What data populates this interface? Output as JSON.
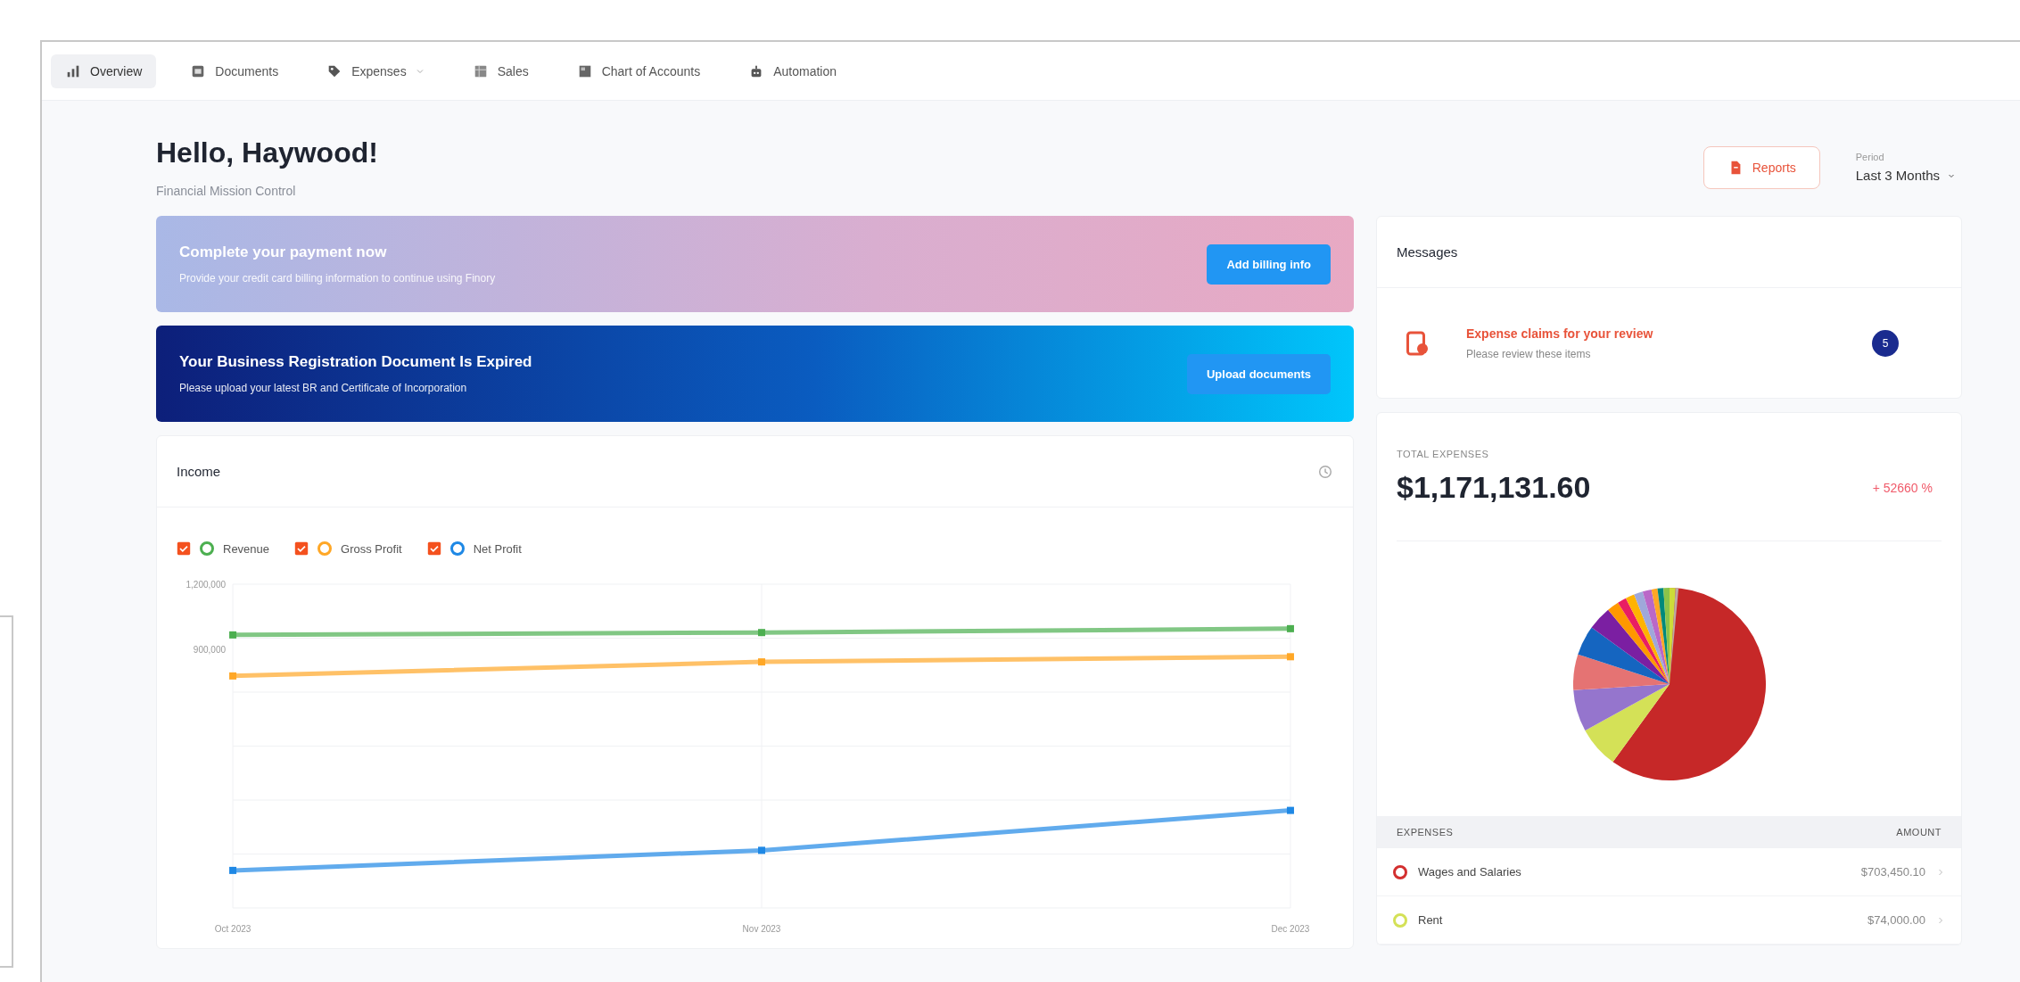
{
  "nav": [
    {
      "label": "Overview",
      "selected": true,
      "has_menu": false
    },
    {
      "label": "Documents",
      "selected": false,
      "has_menu": false
    },
    {
      "label": "Expenses",
      "selected": false,
      "has_menu": true
    },
    {
      "label": "Sales",
      "selected": false,
      "has_menu": false
    },
    {
      "label": "Chart of Accounts",
      "selected": false,
      "has_menu": false
    },
    {
      "label": "Automation",
      "selected": false,
      "has_menu": false
    }
  ],
  "header": {
    "greeting": "Hello, Haywood!",
    "subtitle": "Financial Mission Control",
    "reports_button": "Reports",
    "period": {
      "label": "Period",
      "value": "Last 3 Months"
    }
  },
  "banners": [
    {
      "kind": "payment",
      "title": "Complete your payment now",
      "text": "Provide your credit card billing information to continue using Finory",
      "button": "Add billing info"
    },
    {
      "kind": "document",
      "title": "Your Business Registration Document Is Expired",
      "text": "Please upload your latest BR and Certificate of Incorporation",
      "button": "Upload documents"
    }
  ],
  "income": {
    "title": "Income",
    "legend": [
      {
        "checked": true
      },
      {
        "checked": true
      },
      {
        "checked": true
      }
    ],
    "chart_data": {
      "type": "line",
      "categories": [
        "Oct 2023",
        "Nov 2023",
        "Dec 2023"
      ],
      "series": [
        {
          "name": "Revenue",
          "color": "#4caf50",
          "marker": "square",
          "values": [
            965000,
            976000,
            994000
          ]
        },
        {
          "name": "Gross Profit",
          "color": "#ffa726",
          "marker": "square",
          "values": [
            775000,
            840000,
            864000
          ]
        },
        {
          "name": "Net Profit",
          "color": "#1e88e5",
          "marker": "square",
          "values": [
            -126000,
            -33000,
            152000
          ]
        }
      ],
      "ylim": [
        -300000,
        1200000
      ],
      "yticks": [
        {
          "value": 1200000,
          "label": "1,200,000"
        },
        {
          "value": 900000,
          "label": "900,000"
        }
      ]
    }
  },
  "messages": {
    "title": "Messages",
    "items": [
      {
        "title": "Expense claims for your review",
        "text": "Please review these items",
        "count": "5"
      }
    ]
  },
  "expenses": {
    "label": "TOTAL EXPENSES",
    "amount": "$1,171,131.60",
    "change": "+ 52660 %",
    "columns": [
      "EXPENSES",
      "AMOUNT"
    ],
    "rows": [
      {
        "name": "Wages and Salaries",
        "amount": "$703,450.10",
        "color": "#d32f2f"
      },
      {
        "name": "Rent",
        "amount": "$74,000.00",
        "color": "#d4e157"
      }
    ]
  }
}
